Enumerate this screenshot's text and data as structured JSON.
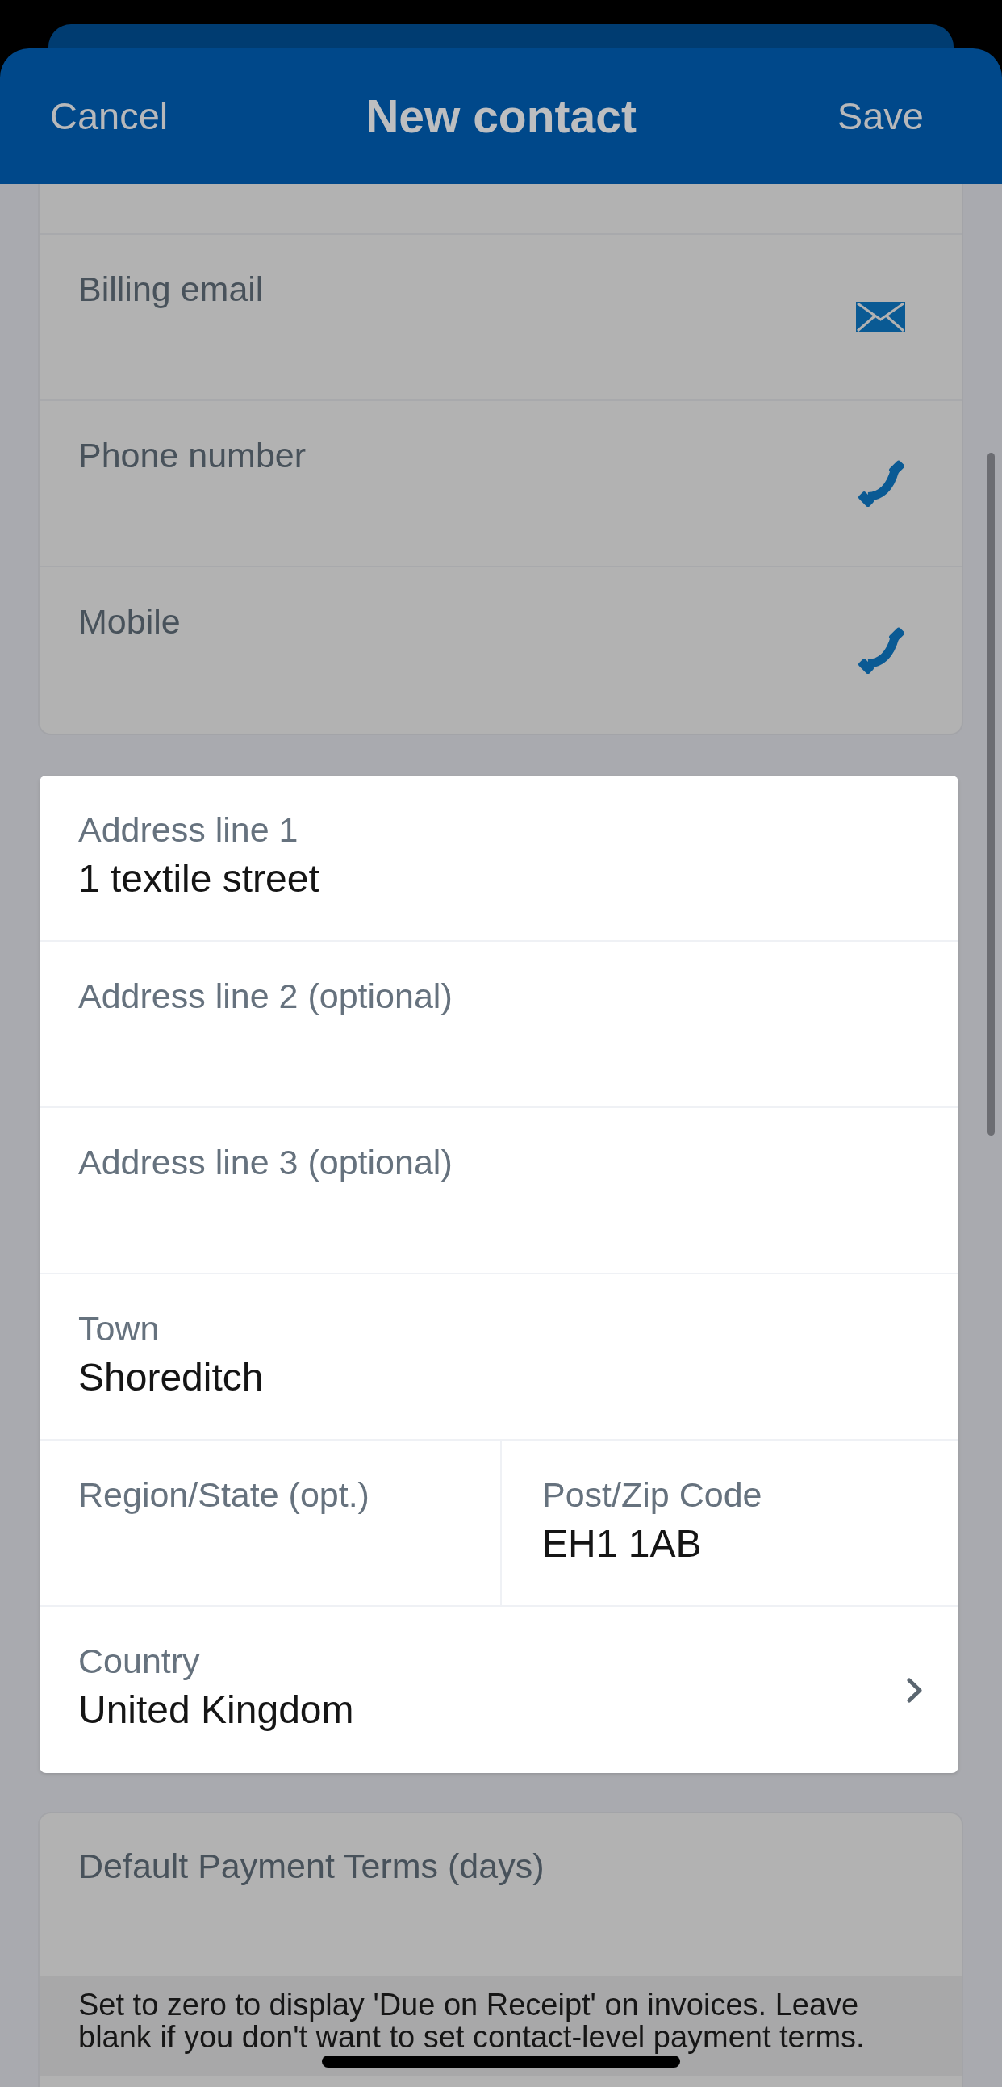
{
  "header": {
    "cancel": "Cancel",
    "title": "New contact",
    "save": "Save"
  },
  "contact": {
    "highlighted": false,
    "fields": [
      {
        "kind": "email",
        "label": "Billing email"
      },
      {
        "kind": "phone",
        "label": "Phone number"
      },
      {
        "kind": "phone",
        "label": "Mobile"
      }
    ]
  },
  "address": {
    "highlighted": true,
    "fields": [
      {
        "kind": "text",
        "label": "Address line 1",
        "value": "1 textile street"
      },
      {
        "kind": "text",
        "label": "Address line 2 (optional)"
      },
      {
        "kind": "text",
        "label": "Address line 3 (optional)"
      },
      {
        "kind": "text",
        "label": "Town",
        "value": "Shoreditch"
      },
      {
        "kind": "pair",
        "fields": [
          {
            "label": "Region/State (opt.)"
          },
          {
            "label": "Post/Zip Code",
            "value": "EH1 1AB"
          }
        ]
      },
      {
        "kind": "select",
        "label": "Country",
        "value": "United Kingdom"
      }
    ]
  },
  "payment_terms": {
    "highlighted": false,
    "label": "Default Payment Terms (days)",
    "hint": "Set to zero to display 'Due on Receipt' on invoices. Leave blank if you don't want to set contact-level payment terms."
  }
}
